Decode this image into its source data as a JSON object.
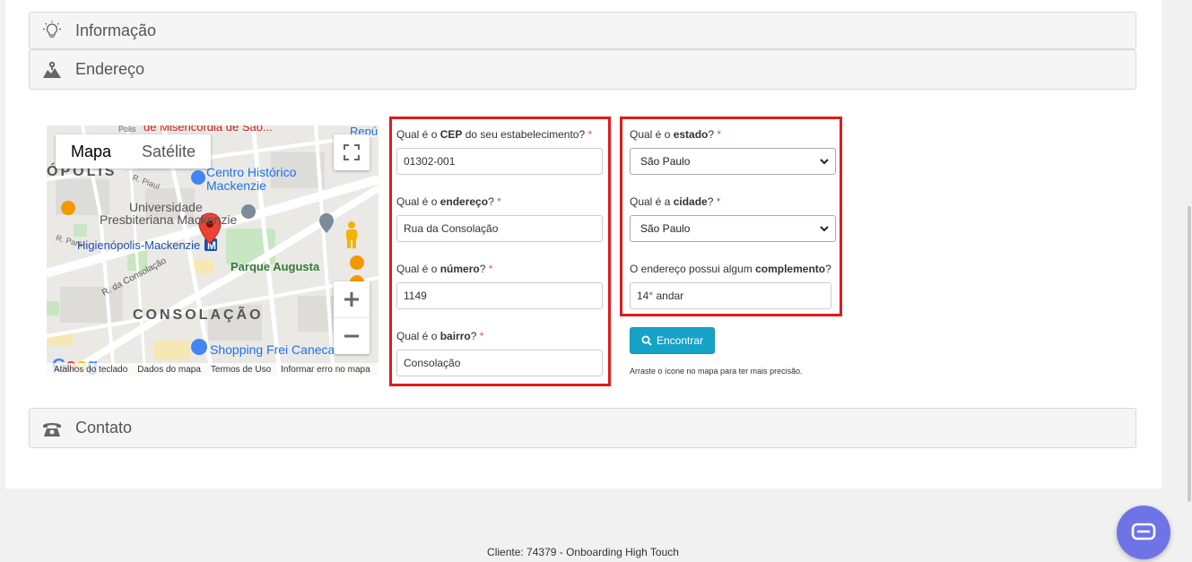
{
  "panels": {
    "info": {
      "title": "Informação",
      "icon": "lightbulb-icon"
    },
    "address": {
      "title": "Endereço",
      "icon": "map-icon"
    },
    "contact": {
      "title": "Contato",
      "icon": "phone-icon"
    }
  },
  "map": {
    "type_map": "Mapa",
    "type_satellite": "Satélite",
    "labels": {
      "top_street": "de Misericórdia de São...",
      "top_right": "Repúb",
      "centro": "Centro Histórico",
      "mackenzie": "Mackenzie",
      "universidade": "Universidade",
      "presbiteriana": "Presbiteriana Mackenzie",
      "metro": "Higienópolis-Mackenzie",
      "parque": "Parque Augusta",
      "rua_consolacao": "R. da Consolação",
      "bairro": "CONSOLAÇÃO",
      "shopping": "Shopping Frei Caneca",
      "polis": "ÓPOLIS",
      "r_piaui": "R. Piauí",
      "r_para": "R. Pará",
      "polis_top": "Polis"
    },
    "footer": [
      "Atalhos do teclado",
      "Dados do mapa",
      "Termos de Uso",
      "Informar erro no mapa"
    ],
    "google": "Google"
  },
  "form": {
    "cep": {
      "q1": "Qual é o ",
      "bold": "CEP",
      "q2": " do seu estabelecimento?",
      "req": "*",
      "value": "01302-001"
    },
    "endereco": {
      "q1": "Qual é o ",
      "bold": "endereço",
      "q2": "?",
      "req": "*",
      "value": "Rua da Consolação"
    },
    "numero": {
      "q1": "Qual é o ",
      "bold": "número",
      "q2": "?",
      "req": "*",
      "value": "1149"
    },
    "bairro": {
      "q1": "Qual é o ",
      "bold": "bairro",
      "q2": "?",
      "req": "*",
      "value": "Consolação"
    },
    "estado": {
      "q1": "Qual é o ",
      "bold": "estado",
      "q2": "?",
      "req": "*",
      "value": "São Paulo"
    },
    "cidade": {
      "q1": "Qual é a ",
      "bold": "cidade",
      "q2": "?",
      "req": "*",
      "value": "São Paulo"
    },
    "complemento": {
      "q1": "O endereço possui algum ",
      "bold": "complemento",
      "q2": "?",
      "value": "14° andar"
    },
    "find_button": "Encontrar",
    "hint": "Arraste o ícone no mapa para ter mais precisão."
  },
  "footer": {
    "client": "Cliente: 74379 - Onboarding High Touch"
  },
  "colors": {
    "highlight": "#e01b1b",
    "button": "#17a2c8",
    "chat": "#6e74e6"
  }
}
